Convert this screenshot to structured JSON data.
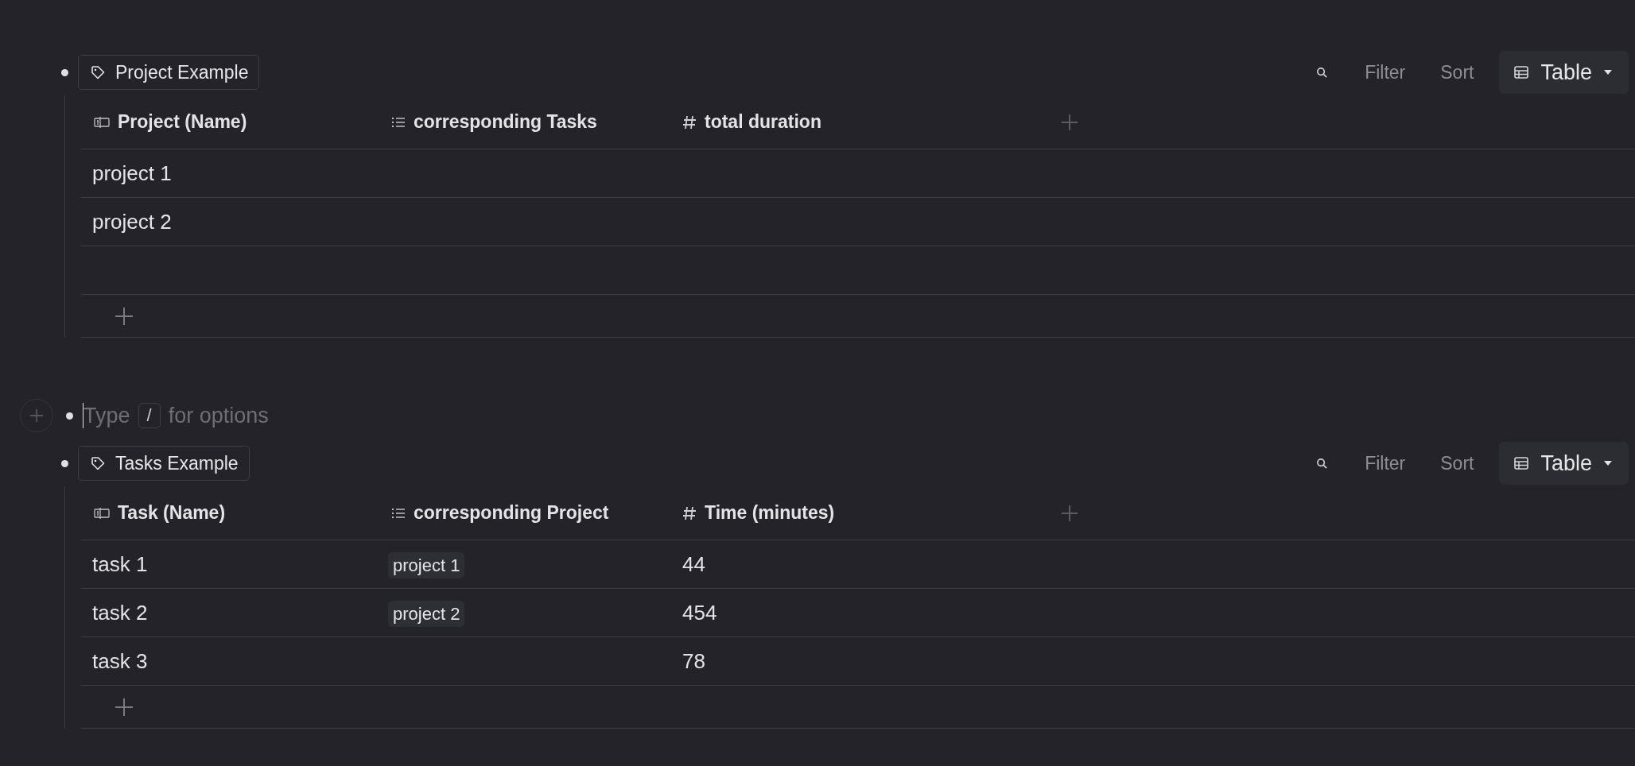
{
  "blocks": [
    {
      "kind": "database",
      "tag": "Project Example",
      "toolbar": {
        "filter": "Filter",
        "sort": "Sort",
        "view": "Table"
      },
      "columns": [
        {
          "kind": "name",
          "label": "Project (Name)"
        },
        {
          "kind": "relation",
          "label": "corresponding Tasks"
        },
        {
          "kind": "number",
          "label": "total duration"
        }
      ],
      "rows": [
        {
          "kind": "item",
          "name": "project 1"
        },
        {
          "kind": "item",
          "name": "project 2"
        },
        {
          "kind": "blank"
        }
      ]
    },
    {
      "kind": "editor",
      "placeholder_before": "Type",
      "key": "/",
      "placeholder_after": "for options"
    },
    {
      "kind": "database",
      "tag": "Tasks Example",
      "toolbar": {
        "filter": "Filter",
        "sort": "Sort",
        "view": "Table"
      },
      "columns": [
        {
          "kind": "name",
          "label": "Task (Name)"
        },
        {
          "kind": "relation",
          "label": "corresponding Project"
        },
        {
          "kind": "number",
          "label": "Time (minutes)"
        }
      ],
      "rows": [
        {
          "kind": "item",
          "name": "task 1",
          "relation": "project 1",
          "number": "44"
        },
        {
          "kind": "item",
          "name": "task 2",
          "relation": "project 2",
          "number": "454"
        },
        {
          "kind": "item",
          "name": "task 3",
          "number": "78"
        }
      ]
    }
  ]
}
